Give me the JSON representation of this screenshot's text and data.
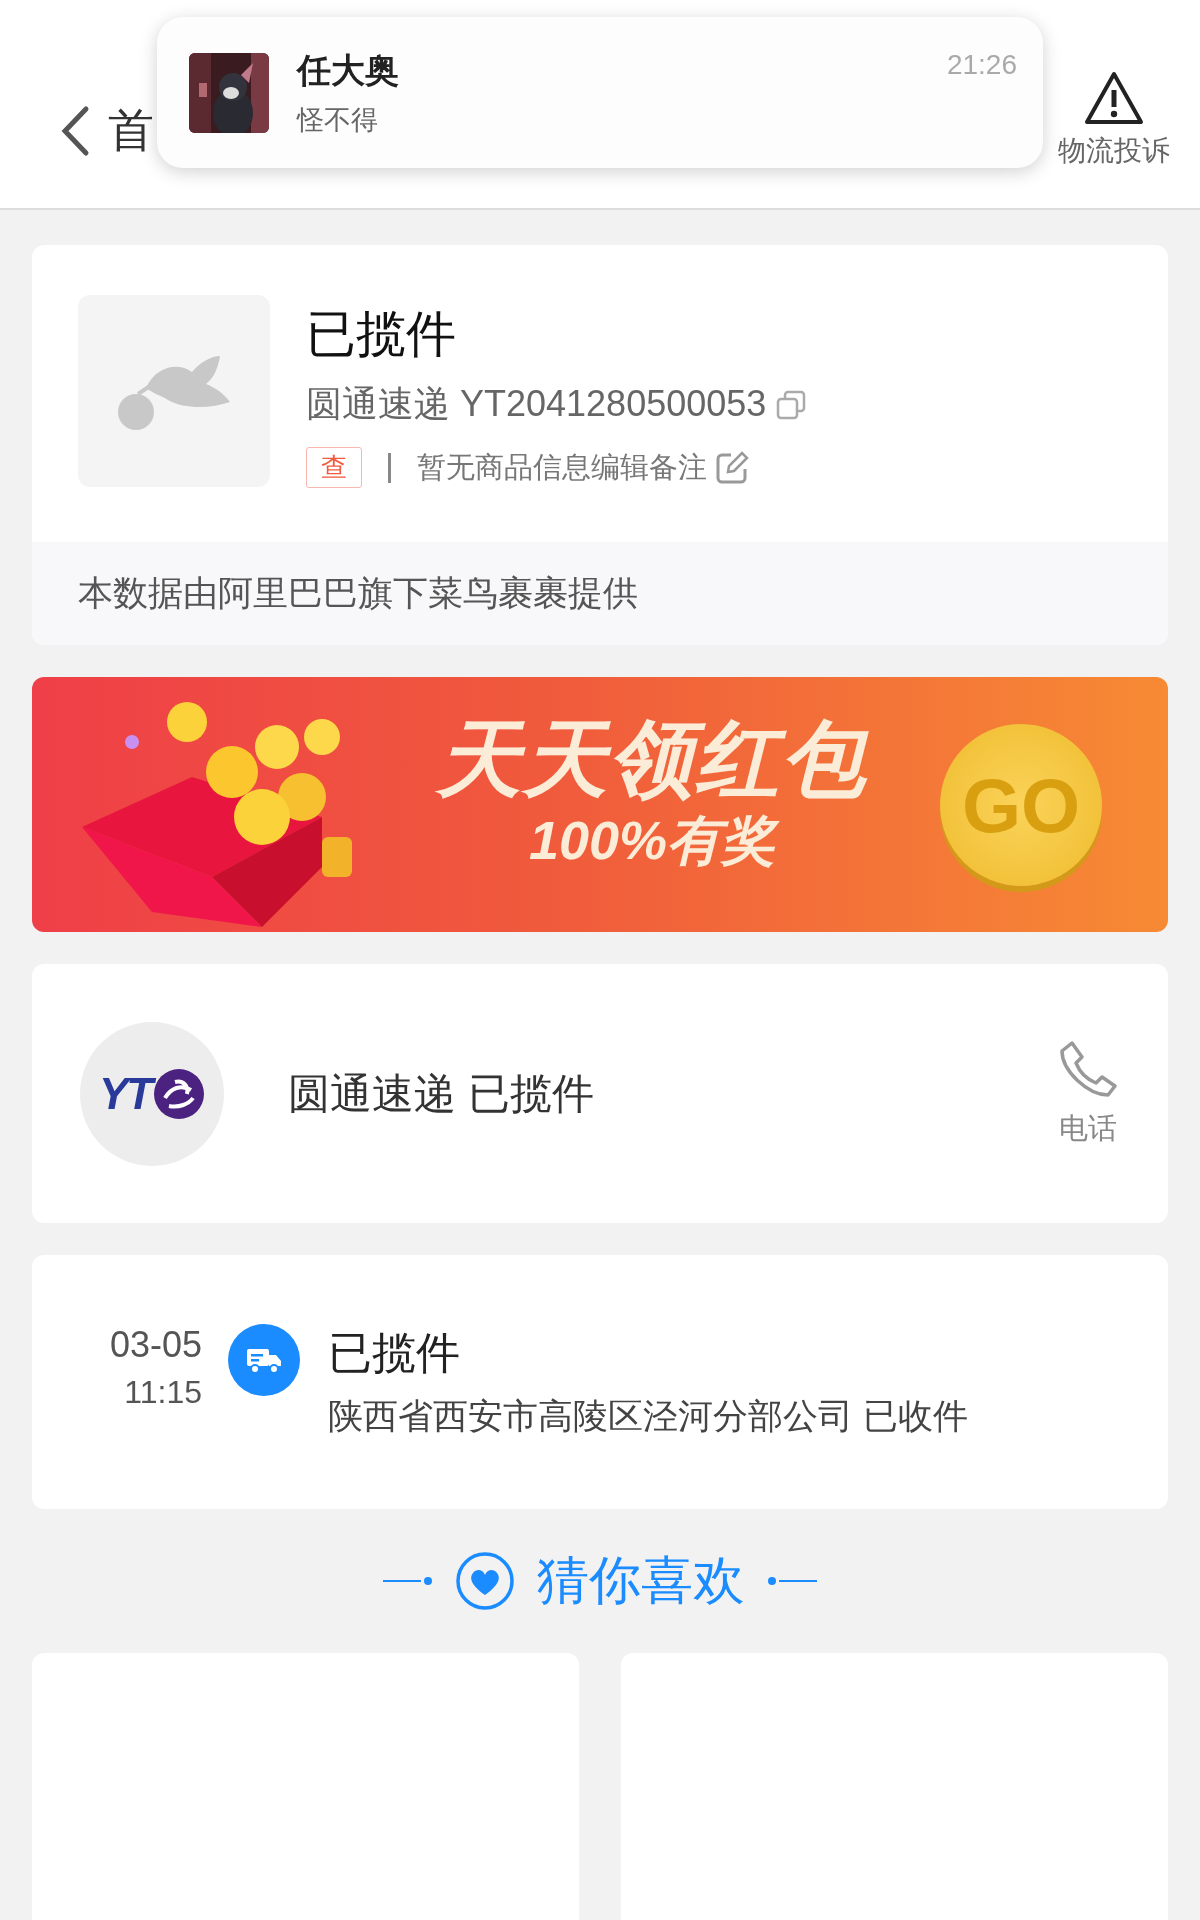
{
  "header": {
    "back_label": "首",
    "actions": [
      {
        "kind": "complaint",
        "label": "物流投诉"
      }
    ]
  },
  "notification": {
    "sender": "任大奥",
    "message": "怪不得",
    "time": "21:26"
  },
  "parcel": {
    "status": "已揽件",
    "carrier": "圆通速递",
    "tracking_number": "YT2041280500053",
    "query_tag": "查",
    "note": "暂无商品信息编辑备注",
    "source": "本数据由阿里巴巴旗下菜鸟裹裹提供"
  },
  "banner": {
    "title": "天天领红包",
    "subtitle": "100%有奖",
    "button": "GO"
  },
  "carrier": {
    "logo_text": "YT",
    "name": "圆通速递",
    "status": "已揽件",
    "phone_label": "电话"
  },
  "tracking": [
    {
      "date": "03-05",
      "time": "11:15",
      "title": "已揽件",
      "detail": "陕西省西安市高陵区泾河分部公司 已收件"
    }
  ],
  "recommendations": {
    "title": "猜你喜欢",
    "items": [
      {
        "kind": "product"
      },
      {
        "kind": "product"
      }
    ]
  }
}
